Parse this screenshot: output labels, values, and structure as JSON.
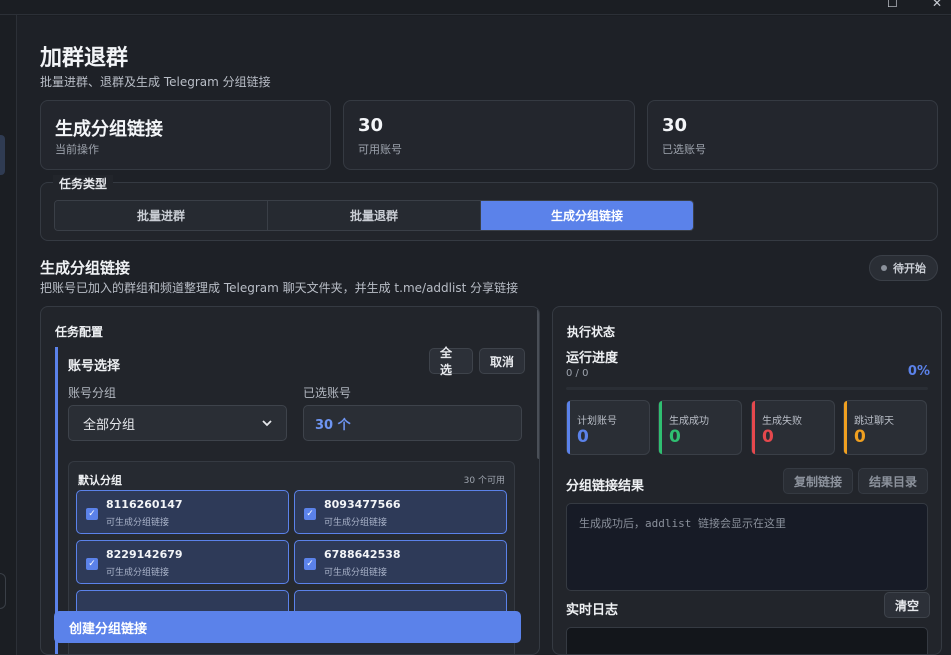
{
  "window": {
    "maximize_glyph": "☐",
    "close_glyph": "✕"
  },
  "page": {
    "title": "加群退群",
    "subtitle": "批量进群、退群及生成 Telegram 分组链接"
  },
  "stats": [
    {
      "value": "生成分组链接",
      "label": "当前操作"
    },
    {
      "value": "30",
      "label": "可用账号"
    },
    {
      "value": "30",
      "label": "已选账号"
    }
  ],
  "task_type": {
    "legend": "任务类型",
    "options": [
      "批量进群",
      "批量退群",
      "生成分组链接"
    ],
    "active_index": 2
  },
  "section": {
    "title": "生成分组链接",
    "subtitle": "把账号已加入的群组和频道整理成 Telegram 聊天文件夹，并生成 t.me/addlist 分享链接",
    "status": "待开始"
  },
  "config": {
    "title": "任务配置",
    "account_select": {
      "title": "账号选择",
      "select_all": "全选",
      "cancel": "取消",
      "group_label": "账号分组",
      "group_value": "全部分组",
      "selected_label": "已选账号",
      "selected_value": "30 个"
    },
    "group": {
      "name": "默认分组",
      "available": "30 个可用",
      "accounts": [
        {
          "number": "8116260147",
          "status": "可生成分组链接",
          "checked": true
        },
        {
          "number": "8093477566",
          "status": "可生成分组链接",
          "checked": true
        },
        {
          "number": "8229142679",
          "status": "可生成分组链接",
          "checked": true
        },
        {
          "number": "6788642538",
          "status": "可生成分组链接",
          "checked": true
        }
      ]
    },
    "create_button": "创建分组链接"
  },
  "execution": {
    "title": "执行状态",
    "progress_title": "运行进度",
    "progress_count": "0 / 0",
    "progress_percent": "0%",
    "progress_value": 0,
    "mini_stats": [
      {
        "label": "计划账号",
        "value": "0",
        "color": "#5b82ea"
      },
      {
        "label": "生成成功",
        "value": "0",
        "color": "#2fbf71"
      },
      {
        "label": "生成失败",
        "value": "0",
        "color": "#e5484d"
      },
      {
        "label": "跳过聊天",
        "value": "0",
        "color": "#f0a020"
      }
    ],
    "result_title": "分组链接结果",
    "copy_link": "复制链接",
    "result_dir": "结果目录",
    "result_placeholder": "生成成功后，addlist 链接会显示在这里",
    "log_title": "实时日志",
    "clear": "清空"
  },
  "colors": {
    "accent": "#5b82ea",
    "background": "#1e2127",
    "panel": "#22252b"
  }
}
